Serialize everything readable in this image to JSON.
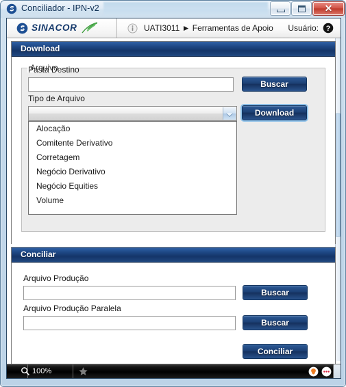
{
  "window": {
    "title": "Conciliador - IPN-v2",
    "icon": "sinacor-s-icon",
    "controls": {
      "minimize": "minimize-button",
      "restore": "restore-button",
      "close_glyph": "✕"
    }
  },
  "brandbar": {
    "logo_word": "SINACOR",
    "breadcrumb": "UATI3011 ► Ferramentas de Apoio",
    "user_label": "Usuário:"
  },
  "download_panel": {
    "header": "Download",
    "fieldset_legend": "Arquivo",
    "pasta_destino": {
      "label": "Pasta Destino",
      "value": "",
      "placeholder": ""
    },
    "buscar_label": "Buscar",
    "tipo_arquivo": {
      "label": "Tipo de Arquivo",
      "value": "",
      "options": [
        "Alocação",
        "Comitente Derivativo",
        "Corretagem",
        "Negócio Derivativo",
        "Negócio Equities",
        "Volume"
      ]
    },
    "download_label": "Download"
  },
  "conciliar_panel": {
    "header": "Conciliar",
    "arquivo_producao": {
      "label": "Arquivo Produção",
      "value": "",
      "placeholder": ""
    },
    "arquivo_producao_paralela": {
      "label": "Arquivo Produção Paralela",
      "value": "",
      "placeholder": ""
    },
    "buscar_label": "Buscar",
    "conciliar_label": "Conciliar"
  },
  "statusbar": {
    "zoom": "100%"
  },
  "colors": {
    "panel_header_blue": "#1d4683",
    "button_blue": "#1c3f74",
    "brand_navy": "#14386b",
    "brand_green": "#3a9a3a",
    "close_red": "#bf3b2d",
    "focus_glow": "#8fc2ea"
  }
}
